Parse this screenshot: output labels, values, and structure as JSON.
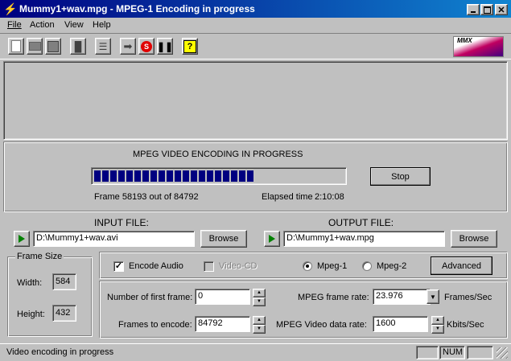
{
  "window": {
    "title": "Mummy1+wav.mpg - MPEG-1 Encoding in progress"
  },
  "menu": {
    "items": [
      "File",
      "Action",
      "View",
      "Help"
    ]
  },
  "toolbar": {
    "icons": [
      "new-file-icon",
      "open-folder-icon",
      "save-disk-icon",
      "binoculars-icon",
      "list-icon",
      "go-arrow-icon",
      "stop-record-icon",
      "pause-icon",
      "help-icon"
    ],
    "logo_text": "MMX"
  },
  "progress": {
    "heading": "MPEG VIDEO ENCODING IN PROGRESS",
    "fraction": 0.686,
    "stop_label": "Stop",
    "frame_text": "Frame 58193 out of 84792",
    "elapsed_label": "Elapsed time",
    "elapsed_value": "2:10:08"
  },
  "files": {
    "input_label": "INPUT FILE:",
    "input_value": "D:\\Mummy1+wav.avi",
    "output_label": "OUTPUT FILE:",
    "output_value": "D:\\Mummy1+wav.mpg",
    "browse_label": "Browse"
  },
  "frame_size": {
    "title": "Frame Size",
    "width_label": "Width:",
    "width_value": "584",
    "height_label": "Height:",
    "height_value": "432"
  },
  "options": {
    "encode_audio_label": "Encode Audio",
    "encode_audio_checked": true,
    "video_cd_label": "Video-CD",
    "mpeg1_label": "Mpeg-1",
    "mpeg2_label": "Mpeg-2",
    "selected_format": "Mpeg-1",
    "advanced_label": "Advanced"
  },
  "params": {
    "first_frame_label": "Number of first frame:",
    "first_frame_value": "0",
    "frames_to_encode_label": "Frames to encode:",
    "frames_to_encode_value": "84792",
    "frame_rate_label": "MPEG frame rate:",
    "frame_rate_value": "23.976",
    "frame_rate_unit": "Frames/Sec",
    "data_rate_label": "MPEG Video data rate:",
    "data_rate_value": "1600",
    "data_rate_unit": "Kbits/Sec"
  },
  "status": {
    "text": "Video encoding in progress",
    "num": "NUM"
  },
  "colors": {
    "title_start": "#000080",
    "title_end": "#1084d0",
    "progress_fill": "#000080"
  }
}
